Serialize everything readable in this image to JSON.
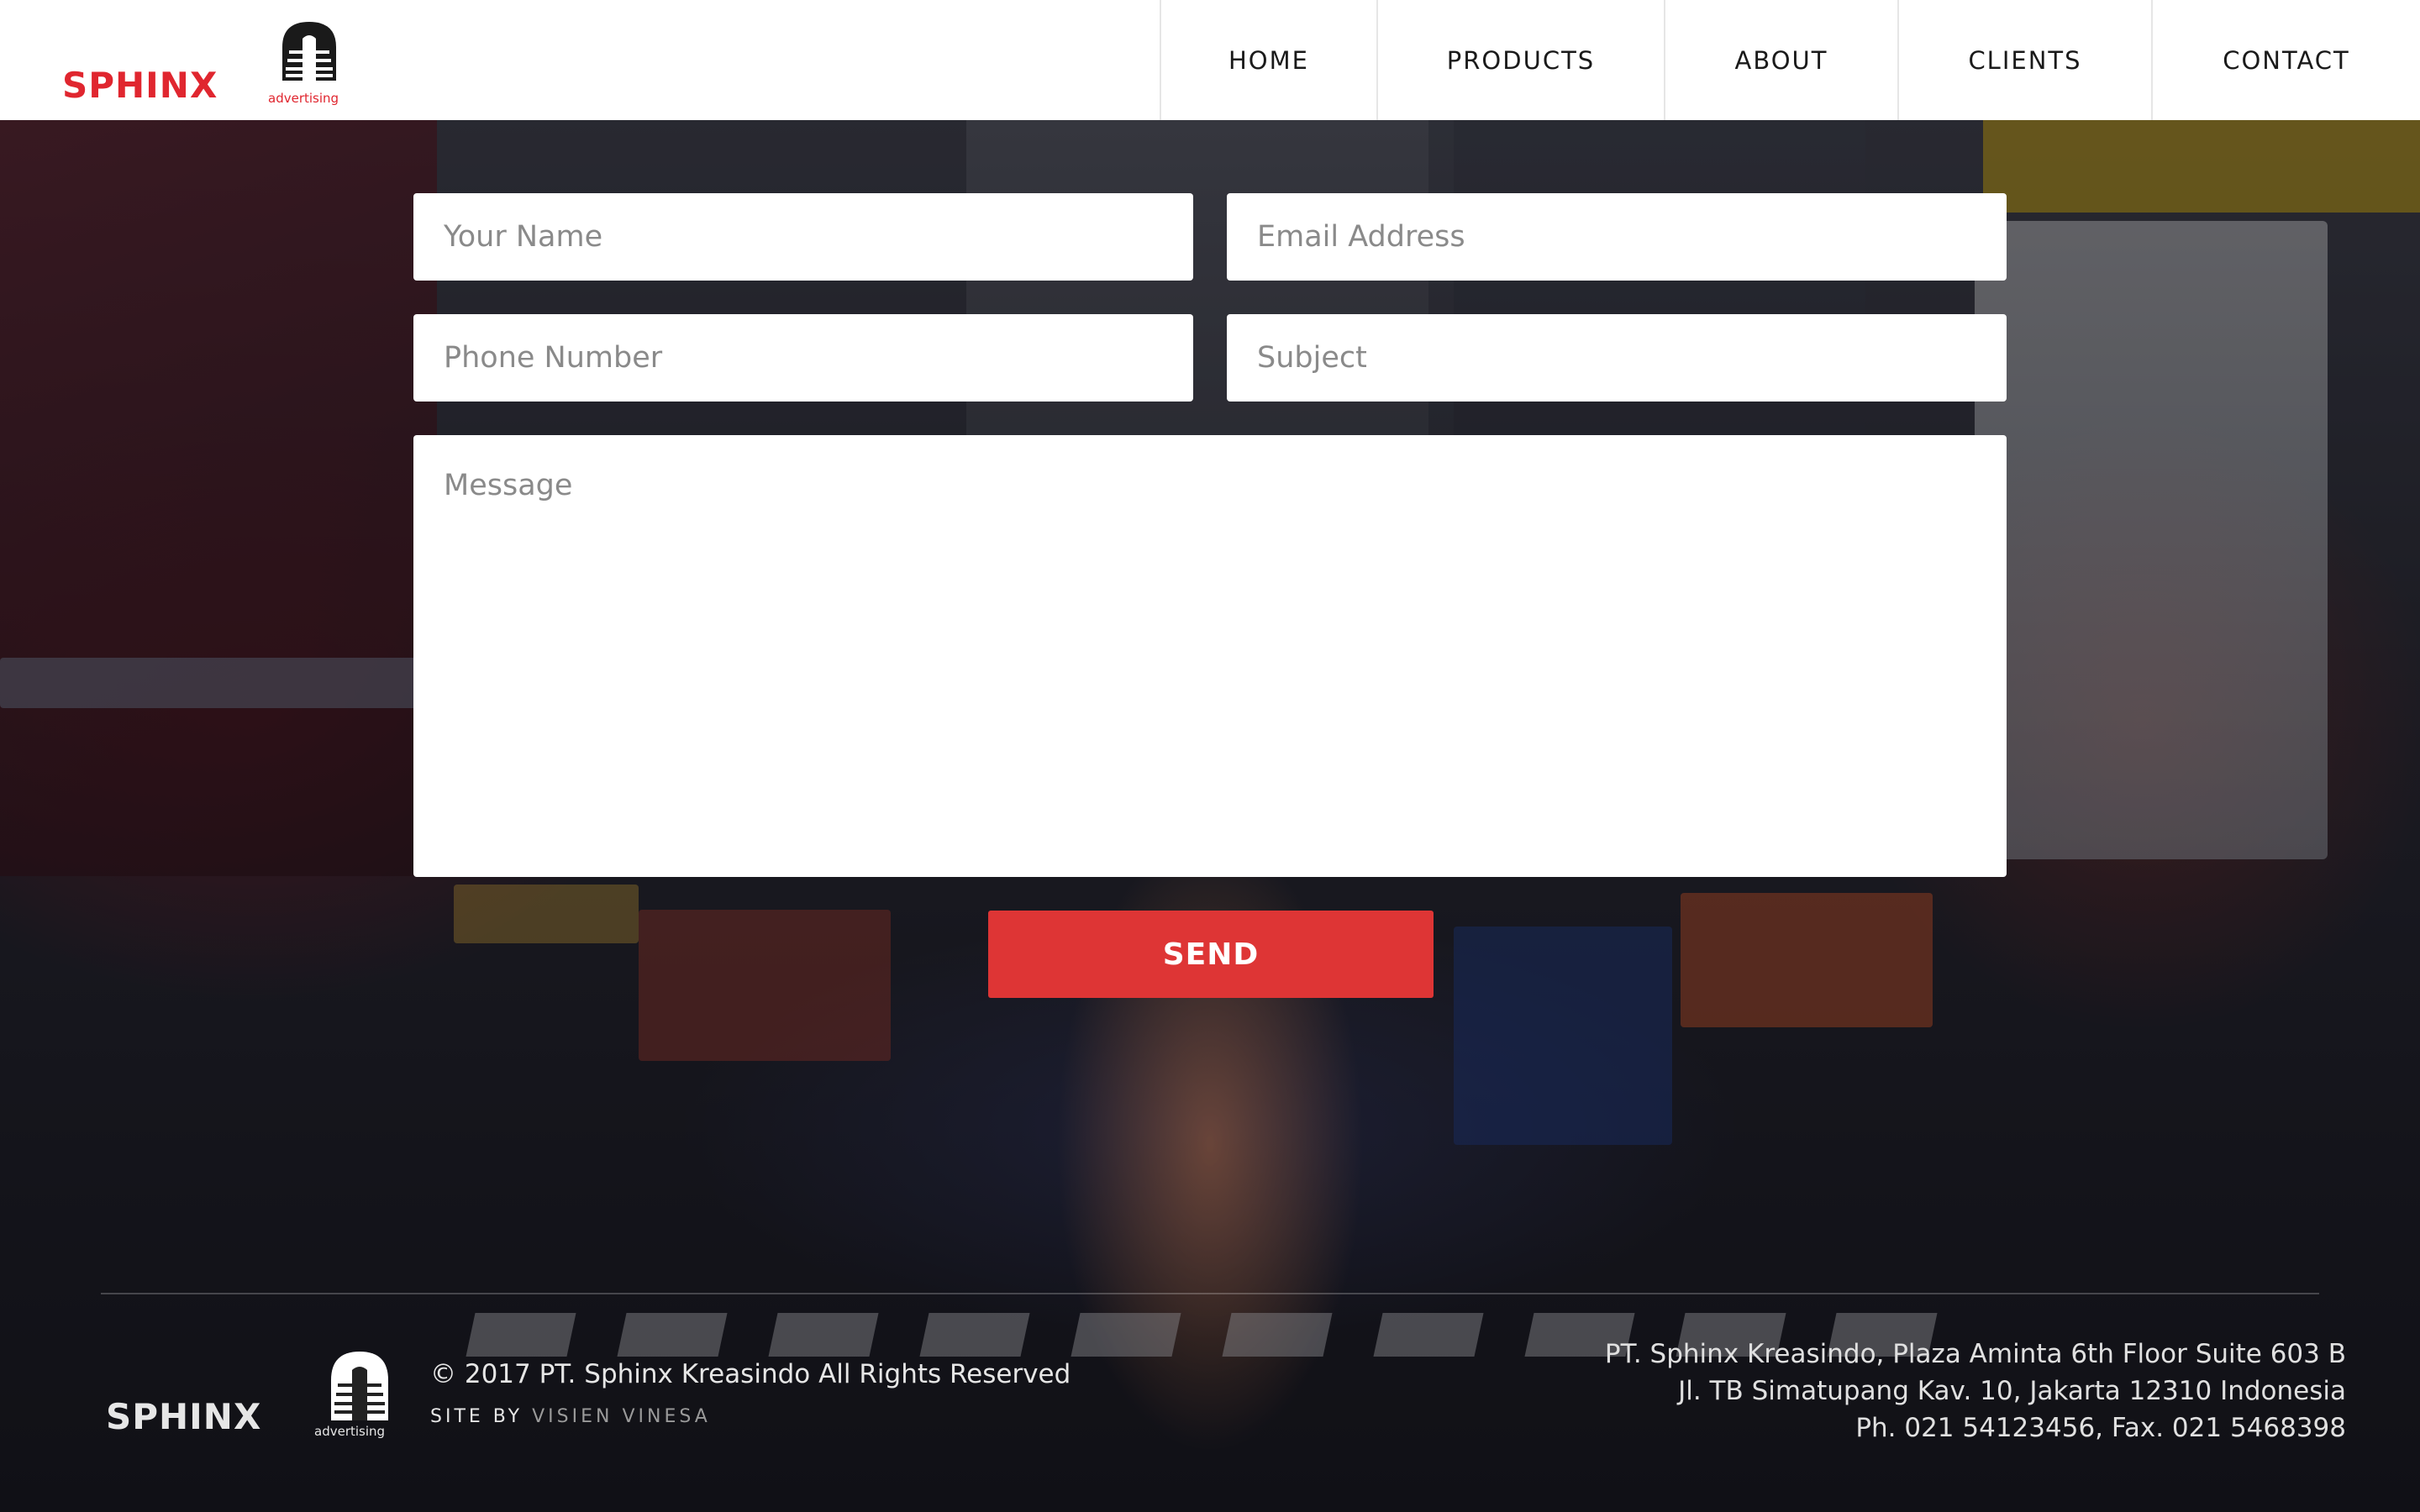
{
  "header": {
    "logo": {
      "wordmark": "SPHINX",
      "tagline": "advertising",
      "icon": "sphinx-dome-icon",
      "accent_color": "#e0262f"
    },
    "nav": [
      {
        "label": "HOME"
      },
      {
        "label": "PRODUCTS"
      },
      {
        "label": "ABOUT"
      },
      {
        "label": "CLIENTS"
      },
      {
        "label": "CONTACT"
      }
    ]
  },
  "contact_form": {
    "name": {
      "placeholder": "Your Name",
      "value": ""
    },
    "email": {
      "placeholder": "Email Address",
      "value": ""
    },
    "phone": {
      "placeholder": "Phone Number",
      "value": ""
    },
    "subject": {
      "placeholder": "Subject",
      "value": ""
    },
    "message": {
      "placeholder": "Message",
      "value": ""
    },
    "send_label": "SEND",
    "send_color": "#de3535"
  },
  "footer": {
    "logo": {
      "wordmark": "SPHINX",
      "tagline": "advertising",
      "icon": "sphinx-dome-icon"
    },
    "copyright": "© 2017 PT. Sphinx Kreasindo All Rights Reserved",
    "site_by_label": "SITE BY",
    "site_by_credit": "VISIEN VINESA",
    "address_lines": [
      "PT. Sphinx Kreasindo, Plaza Aminta 6th Floor Suite 603 B",
      "Jl. TB Simatupang Kav. 10, Jakarta 12310 Indonesia",
      "Ph. 021 54123456, Fax. 021 5468398"
    ]
  }
}
